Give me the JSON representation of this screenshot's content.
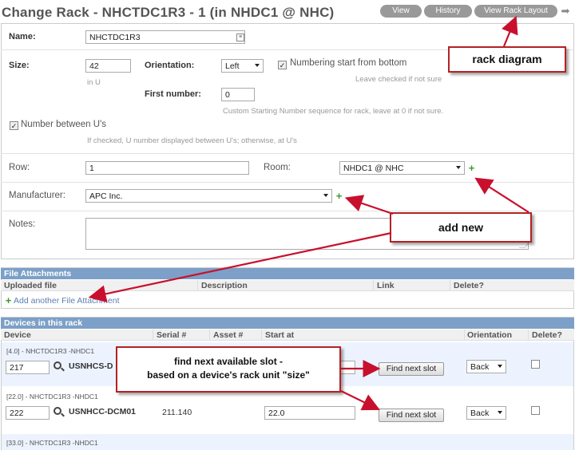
{
  "header": {
    "title": "Change Rack - NHCTDC1R3 - 1 (in NHDC1 @ NHC)",
    "buttons": [
      "View",
      "History",
      "View Rack Layout"
    ]
  },
  "form": {
    "name": {
      "label": "Name:",
      "value": "NHCTDC1R3"
    },
    "size": {
      "label": "Size:",
      "value": "42",
      "help": "in U"
    },
    "orientation": {
      "label": "Orientation:",
      "value": "Left"
    },
    "numbering": {
      "label": "Numbering start from bottom",
      "checked": true,
      "help": "Leave checked if not sure"
    },
    "first_number": {
      "label": "First number:",
      "value": "0",
      "help": "Custom Starting Number sequence for rack, leave at 0 if not sure."
    },
    "between": {
      "label": "Number between U's",
      "checked": true,
      "help": "If checked, U number displayed between U's; otherwise, at U's"
    },
    "row": {
      "label": "Row:",
      "value": "1"
    },
    "room": {
      "label": "Room:",
      "value": "NHDC1 @ NHC"
    },
    "manufacturer": {
      "label": "Manufacturer:",
      "value": "APC Inc."
    },
    "notes": {
      "label": "Notes:",
      "value": ""
    }
  },
  "attachments": {
    "section_title": "File Attachments",
    "columns": [
      "Uploaded file",
      "Description",
      "Link",
      "Delete?"
    ],
    "add_link": "Add another File Attachment"
  },
  "devices": {
    "section_title": "Devices in this rack",
    "columns": [
      "Device",
      "Serial #",
      "Asset #",
      "Start at",
      "Orientation",
      "Delete?"
    ],
    "rows": [
      {
        "label": "[4.0] - NHCTDC1R3 -NHDC1",
        "id": "217",
        "device": "USNHCS-D",
        "serial": "",
        "start": "",
        "button": "Find next slot",
        "orientation": "Back"
      },
      {
        "label": "[22.0] - NHCTDC1R3 -NHDC1",
        "id": "222",
        "device": "USNHCC-DCM01",
        "serial": "211.140",
        "start": "22.0",
        "button": "Find next slot",
        "orientation": "Back"
      },
      {
        "label": "[33.0] - NHCTDC1R3 -NHDC1"
      }
    ]
  },
  "callouts": {
    "rack_diagram": "rack diagram",
    "add_new": "add new",
    "find_slot_line1": "find next available slot -",
    "find_slot_line2": "based on a device's rack unit \"size\""
  },
  "colors": {
    "accent": "#7ca0c7",
    "callout_border": "#b22222",
    "arrow": "#c8102e",
    "plus": "#3a9a2a"
  }
}
